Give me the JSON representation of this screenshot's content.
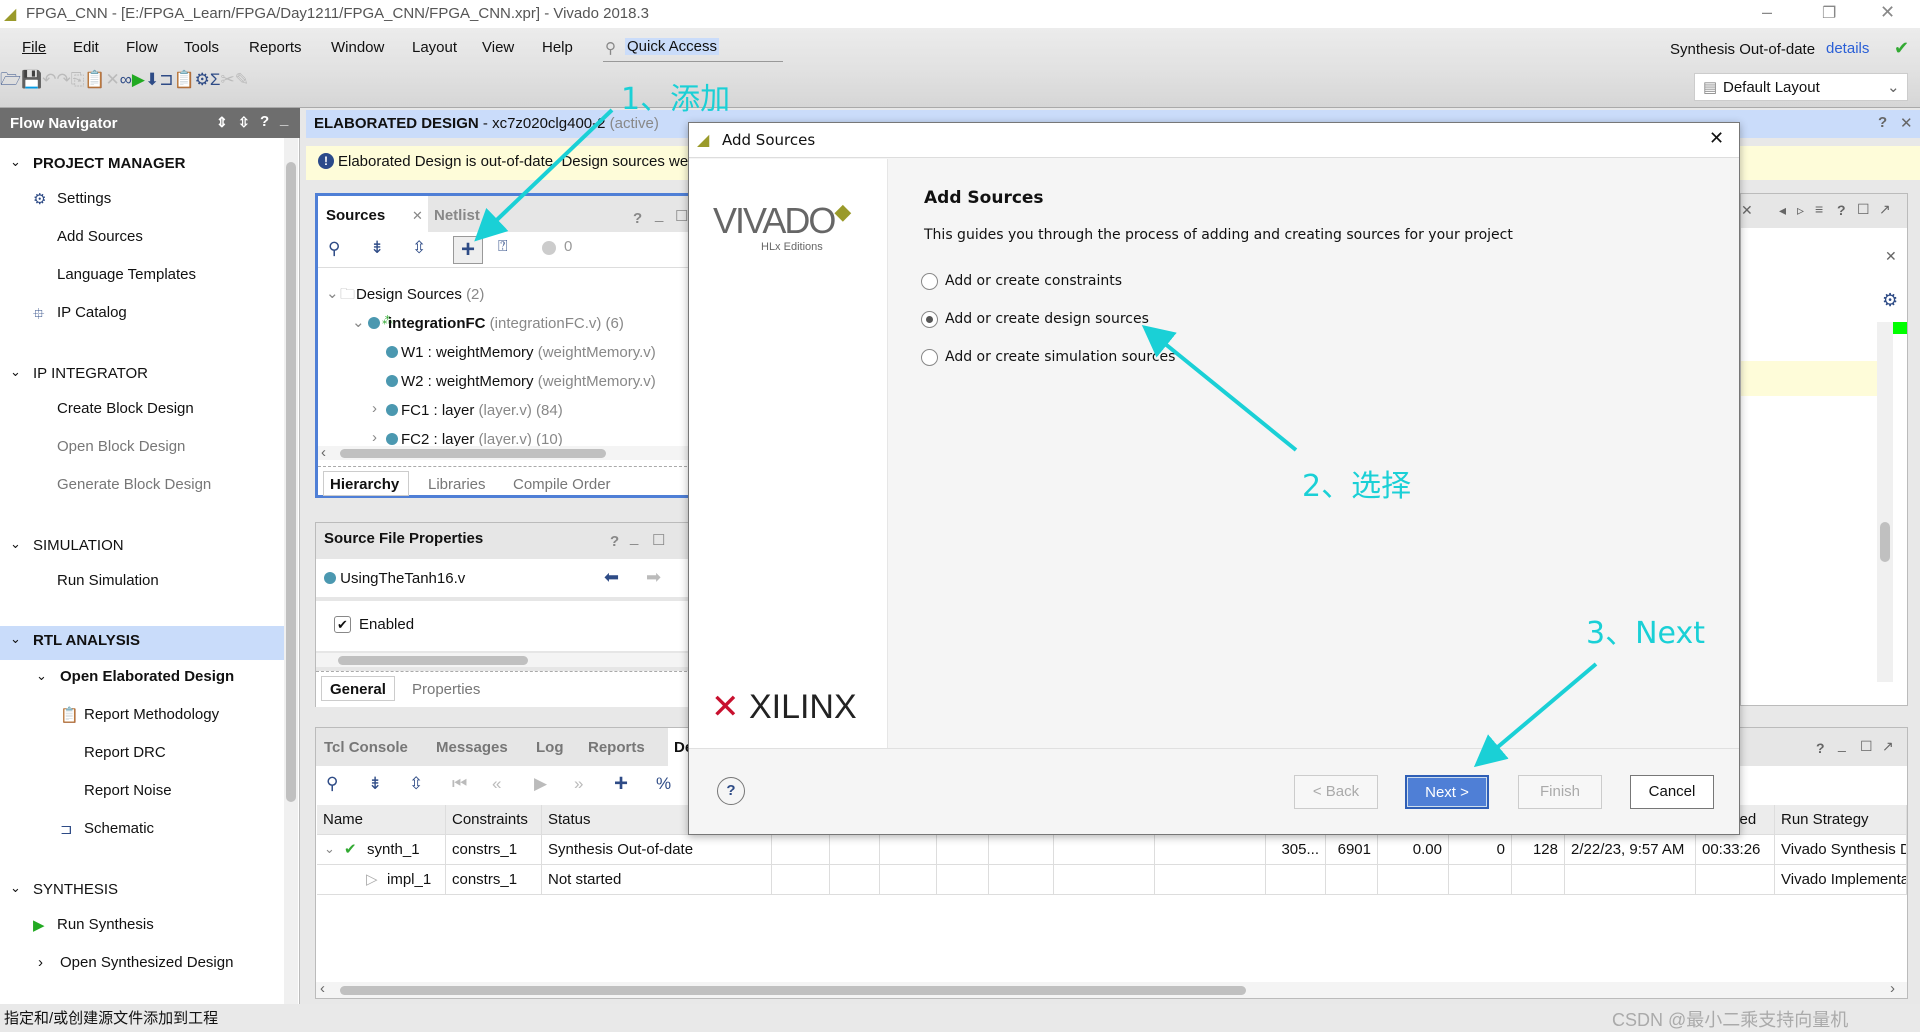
{
  "window": {
    "title": "FPGA_CNN - [E:/FPGA_Learn/FPGA/Day1211/FPGA_CNN/FPGA_CNN.xpr] - Vivado 2018.3",
    "controls": [
      "minimize",
      "restore",
      "close"
    ]
  },
  "menu": {
    "items": [
      "File",
      "Edit",
      "Flow",
      "Tools",
      "Reports",
      "Window",
      "Layout",
      "View",
      "Help"
    ],
    "quick_access": "Quick Access",
    "status": "Synthesis Out-of-date",
    "details": "details",
    "layout": "Default Layout"
  },
  "toolbar": {
    "icons": [
      "open-project-icon",
      "save-icon",
      "undo-icon",
      "redo-icon",
      "copy-icon",
      "paste-icon",
      "delete-icon",
      "binoculars-icon",
      "run-icon",
      "program-icon",
      "schematic-icon",
      "report-icon",
      "settings-icon",
      "sigma-icon",
      "disabled-icon",
      "disabled-icon2"
    ]
  },
  "flow_navigator": {
    "title": "Flow Navigator",
    "sections": [
      {
        "label": "PROJECT MANAGER",
        "items": [
          "Settings",
          "Add Sources",
          "Language Templates",
          "IP Catalog"
        ]
      },
      {
        "label": "IP INTEGRATOR",
        "items": [
          "Create Block Design",
          "Open Block Design",
          "Generate Block Design"
        ]
      },
      {
        "label": "SIMULATION",
        "items": [
          "Run Simulation"
        ]
      },
      {
        "label": "RTL ANALYSIS",
        "items": [
          "Open Elaborated Design",
          "Report Methodology",
          "Report DRC",
          "Report Noise",
          "Schematic"
        ]
      },
      {
        "label": "SYNTHESIS",
        "items": [
          "Run Synthesis",
          "Open Synthesized Design"
        ]
      }
    ]
  },
  "design": {
    "header": "ELABORATED DESIGN",
    "part": " - xc7z020clg400-2",
    "active": "(active)",
    "banner": "Elaborated Design is out-of-date. Design sources were"
  },
  "sources": {
    "tabs": [
      "Sources",
      "Netlist"
    ],
    "count": "0",
    "tree": [
      {
        "name": "Design Sources",
        "extra": "(2)"
      },
      {
        "name": "integrationFC",
        "extra": "(integrationFC.v) (6)"
      },
      {
        "name": "W1 : weightMemory",
        "extra": "(weightMemory.v)"
      },
      {
        "name": "W2 : weightMemory",
        "extra": "(weightMemory.v)"
      },
      {
        "name": "FC1 : layer",
        "extra": "(layer.v) (84)"
      },
      {
        "name": "FC2 : layer",
        "extra": "(layer.v) (10)"
      }
    ],
    "bottom_tabs": [
      "Hierarchy",
      "Libraries",
      "Compile Order"
    ]
  },
  "props": {
    "title": "Source File Properties",
    "file": "UsingTheTanh16.v",
    "enabled": "Enabled",
    "tabs": [
      "General",
      "Properties"
    ]
  },
  "console": {
    "tabs": [
      "Tcl Console",
      "Messages",
      "Log",
      "Reports",
      "De"
    ],
    "headers": [
      "Name",
      "Constraints",
      "Status",
      "",
      "",
      "",
      "",
      "",
      "",
      "",
      "",
      "",
      "",
      "",
      "",
      "",
      "Elapsed",
      "Run Strategy"
    ],
    "rows": [
      [
        "synth_1",
        "constrs_1",
        "Synthesis Out-of-date",
        "",
        "",
        "",
        "",
        "",
        "",
        "",
        "305...",
        "6901",
        "0.00",
        "0",
        "128",
        "2/22/23, 9:57 AM",
        "00:33:26",
        "Vivado Synthesis D"
      ],
      [
        "impl_1",
        "constrs_1",
        "Not started",
        "",
        "",
        "",
        "",
        "",
        "",
        "",
        "",
        "",
        "",
        "",
        "",
        "",
        "",
        "Vivado Implementa"
      ]
    ]
  },
  "dialog": {
    "title": "Add Sources",
    "heading": "Add Sources",
    "description": "This guides you through the process of adding and creating sources for your project",
    "options": [
      {
        "label": "Add or create constraints",
        "selected": false
      },
      {
        "label": "Add or create design sources",
        "selected": true
      },
      {
        "label": "Add or create simulation sources",
        "selected": false
      }
    ],
    "logo": "VIVADO",
    "logo_sub": "HLx Editions",
    "brand": "XILINX",
    "buttons": {
      "back": "< Back",
      "next": "Next >",
      "finish": "Finish",
      "cancel": "Cancel"
    }
  },
  "annotations": [
    "1、添加",
    "2、选择",
    "3、Next"
  ],
  "status_bar": "指定和/或创建源文件添加到工程",
  "watermark": "CSDN @最小二乘支持向量机",
  "colors": {
    "accent": "#4f7fd6",
    "annotation": "#1ad0d6",
    "selection": "#c9dcfa",
    "banner": "#fefcd9"
  }
}
